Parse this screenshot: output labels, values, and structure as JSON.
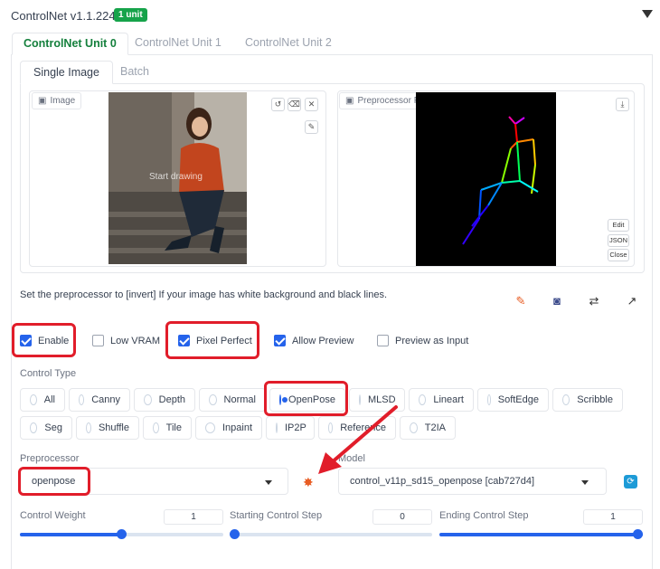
{
  "header": {
    "title": "ControlNet v1.1.224",
    "badge": "1 unit"
  },
  "unit_tabs": [
    "ControlNet Unit 0",
    "ControlNet Unit 1",
    "ControlNet Unit 2"
  ],
  "image_tabs": [
    "Single Image",
    "Batch"
  ],
  "image_panel": {
    "label": "Image",
    "overlay_text": "Start drawing"
  },
  "preview_panel": {
    "label": "Preprocessor Preview",
    "buttons": [
      "Edit",
      "JSON",
      "Close"
    ]
  },
  "hint": "Set the preprocessor to [invert] If your image has white background and black lines.",
  "checkboxes": {
    "enable": {
      "label": "Enable",
      "checked": true
    },
    "low_vram": {
      "label": "Low VRAM",
      "checked": false
    },
    "pixel_perfect": {
      "label": "Pixel Perfect",
      "checked": true
    },
    "allow_preview": {
      "label": "Allow Preview",
      "checked": true
    },
    "preview_as_input": {
      "label": "Preview as Input",
      "checked": false
    }
  },
  "control_type": {
    "label": "Control Type",
    "options": [
      "All",
      "Canny",
      "Depth",
      "Normal",
      "OpenPose",
      "MLSD",
      "Lineart",
      "SoftEdge",
      "Scribble",
      "Seg",
      "Shuffle",
      "Tile",
      "Inpaint",
      "IP2P",
      "Reference",
      "T2IA"
    ],
    "selected": "OpenPose"
  },
  "preprocessor": {
    "label": "Preprocessor",
    "value": "openpose"
  },
  "model": {
    "label": "Model",
    "value": "control_v11p_sd15_openpose [cab727d4]"
  },
  "sliders": {
    "control_weight": {
      "label": "Control Weight",
      "value": "1",
      "fraction": 0.5
    },
    "starting_step": {
      "label": "Starting Control Step",
      "value": "0",
      "fraction": 0.0
    },
    "ending_step": {
      "label": "Ending Control Step",
      "value": "1",
      "fraction": 1.0
    }
  },
  "colors": {
    "accent": "#2563eb",
    "badge": "#16a34a",
    "highlight": "#e11d2a"
  },
  "icons": [
    "collapse-triangle-icon",
    "undo-icon",
    "eraser-icon",
    "close-icon",
    "brush-icon",
    "download-icon",
    "edit-file-icon",
    "camera-icon",
    "swap-icon",
    "send-icon",
    "explosion-icon",
    "refresh-icon"
  ]
}
